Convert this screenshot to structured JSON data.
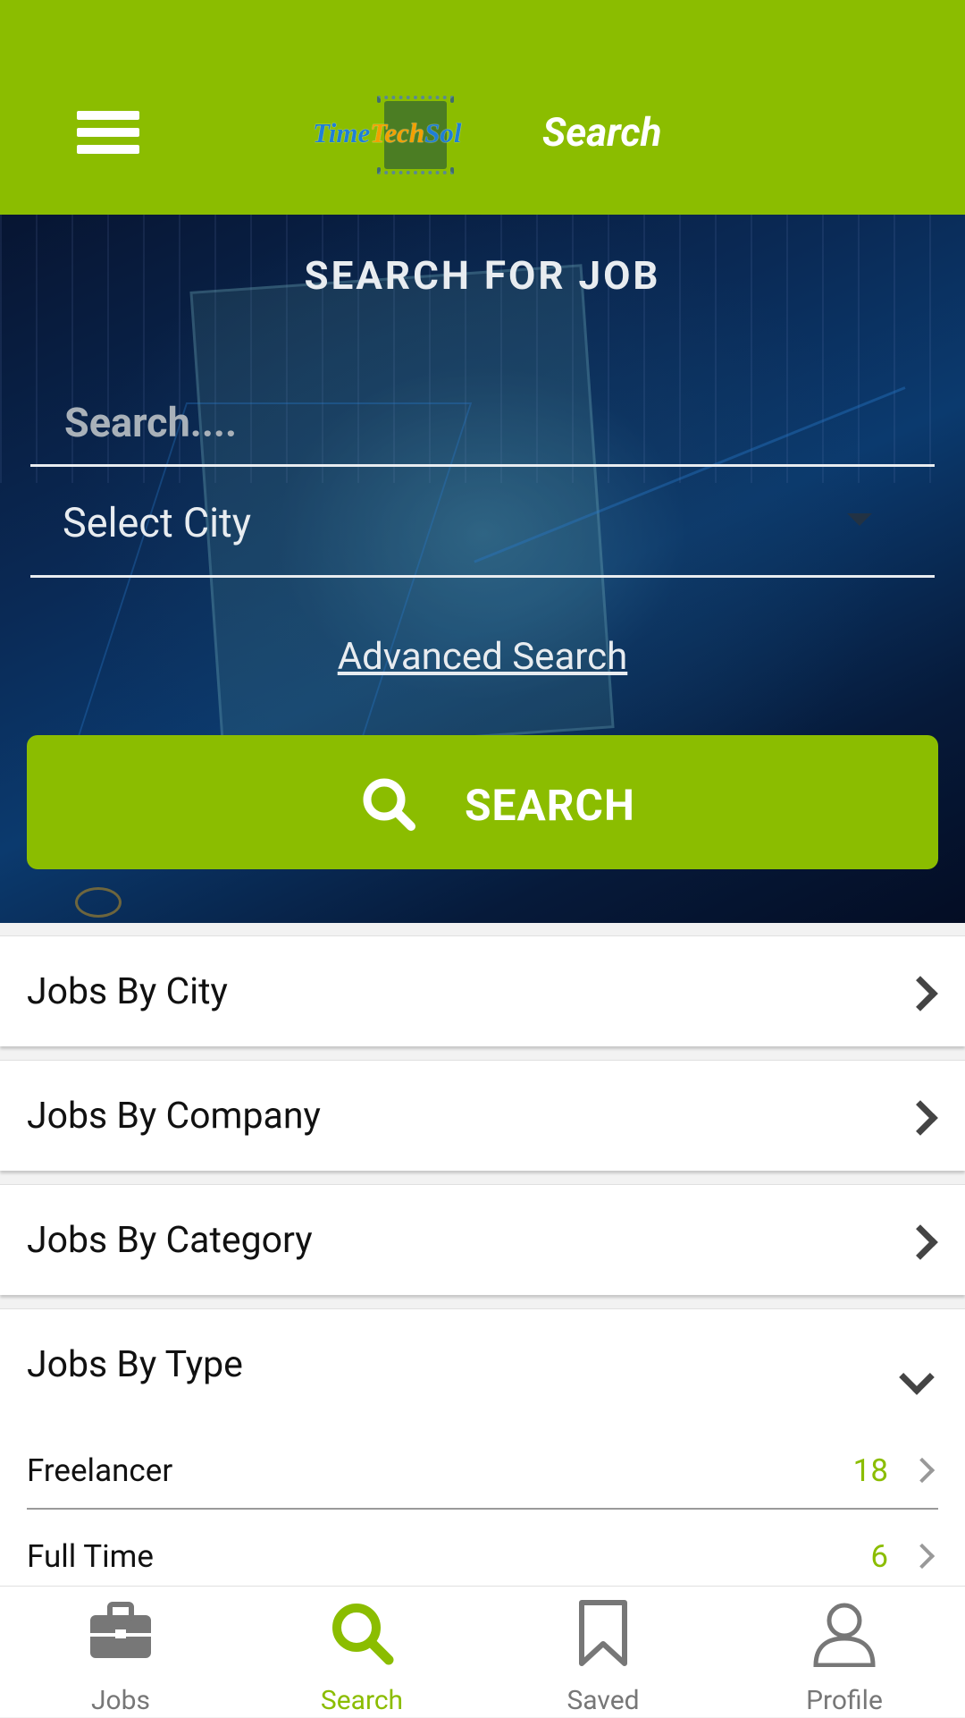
{
  "header": {
    "title": "Search",
    "logo_text": [
      "Time",
      "Tech",
      "Sol"
    ]
  },
  "hero": {
    "title": "SEARCH FOR JOB",
    "search_placeholder": "Search....",
    "city_label": "Select City",
    "advanced_label": "Advanced Search",
    "search_button": "SEARCH"
  },
  "sections": [
    {
      "label": "Jobs By City"
    },
    {
      "label": "Jobs By Company"
    },
    {
      "label": "Jobs By Category"
    },
    {
      "label": "Jobs By Type"
    }
  ],
  "job_types": [
    {
      "name": "Freelancer",
      "count": "18"
    },
    {
      "name": "Full Time",
      "count": "6"
    }
  ],
  "nav": [
    {
      "label": "Jobs",
      "icon": "briefcase-icon"
    },
    {
      "label": "Search",
      "icon": "search-icon"
    },
    {
      "label": "Saved",
      "icon": "bookmark-icon"
    },
    {
      "label": "Profile",
      "icon": "user-icon"
    }
  ],
  "colors": {
    "accent": "#8bbd00",
    "dark": "#0a2a56"
  }
}
